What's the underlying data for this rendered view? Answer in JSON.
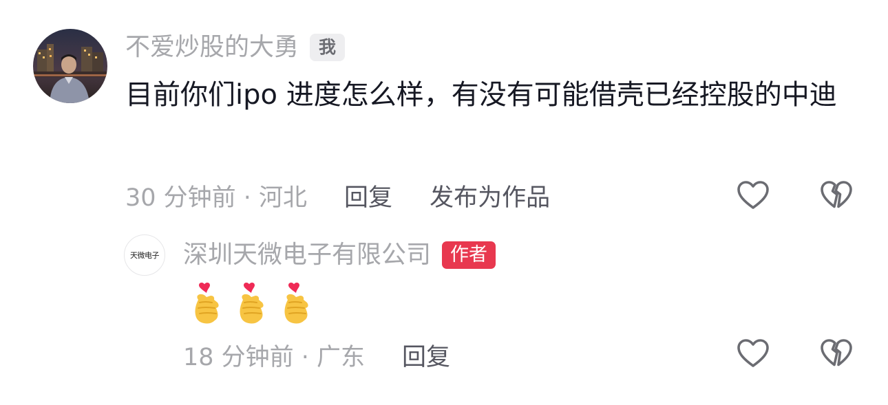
{
  "comment": {
    "username": "不爱炒股的大勇",
    "badge": "我",
    "text": "目前你们ipo 进度怎么样，有没有可能借壳已经控股的中迪",
    "time_location": "30 分钟前 · 河北",
    "reply_label": "回复",
    "publish_label": "发布为作品",
    "like_icon": "heart-outline-icon",
    "dislike_icon": "broken-heart-icon"
  },
  "reply": {
    "avatar_text": "天微电子",
    "username": "深圳天微电子有限公司",
    "badge": "作者",
    "emoji_count": 3,
    "emoji_icon": "finger-heart-emoji",
    "time_location": "18 分钟前 · 广东",
    "reply_label": "回复",
    "like_icon": "heart-outline-icon",
    "dislike_icon": "broken-heart-icon"
  },
  "colors": {
    "username": "#a6a7ab",
    "body_text": "#161823",
    "action_text": "#555660",
    "author_badge": "#e8384f",
    "me_badge_bg": "#eeeef0",
    "icon": "#6b6c72"
  }
}
